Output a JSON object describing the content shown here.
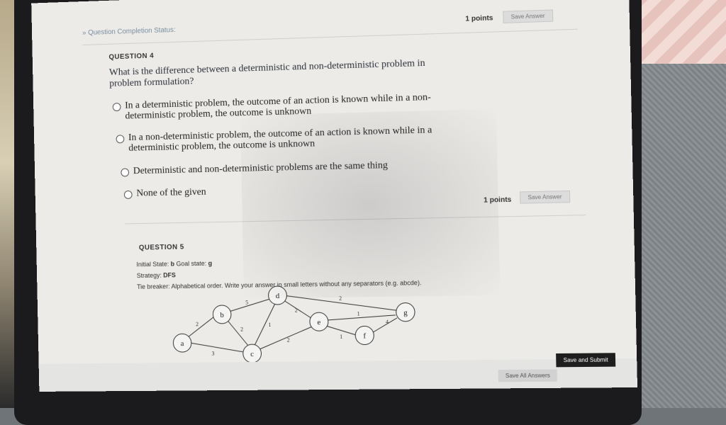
{
  "status": {
    "completion_link": "» Question Completion Status:"
  },
  "question4": {
    "title": "QUESTION 4",
    "points": "1 points",
    "save_label": "Save Answer",
    "text": "What is the difference between a deterministic and non-deterministic problem in problem formulation?",
    "options": [
      "In a deterministic problem, the outcome of an action is known while in a non-deterministic problem, the outcome is unknown",
      "In a non-deterministic problem, the outcome of an action is known while in a deterministic problem, the outcome is unknown",
      "Deterministic and non-deterministic problems are the same thing",
      "None of the given"
    ]
  },
  "question5": {
    "title": "QUESTION 5",
    "points": "1 points",
    "save_label": "Save Answer",
    "initial_label": "Initial State:",
    "initial_value": "b",
    "goal_label": "Goal state:",
    "goal_value": "g",
    "strategy_label": "Strategy:",
    "strategy_value": "DFS",
    "tiebreaker": "Tie breaker: Alphabetical order. Write your answer in small letters without any separators (e.g. abcde).",
    "graph": {
      "nodes": [
        "a",
        "b",
        "c",
        "d",
        "e",
        "f",
        "g"
      ],
      "edge_labels": [
        "2",
        "3",
        "5",
        "2",
        "1",
        "2",
        "2",
        "2",
        "1",
        "1",
        "4"
      ]
    }
  },
  "footer": {
    "save_all": "Save All Answers",
    "save_submit": "Save and Submit"
  }
}
